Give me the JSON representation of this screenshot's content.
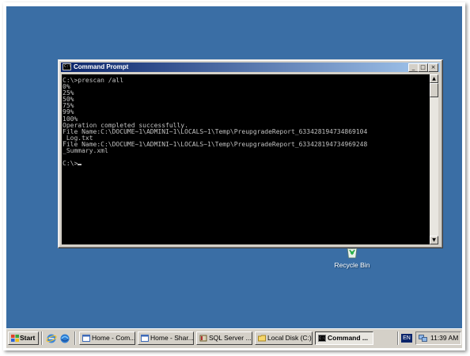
{
  "desktop": {
    "background_color": "#3a6ea5",
    "icons": [
      {
        "label": "Recycle Bin",
        "icon": "recycle-bin-icon"
      }
    ]
  },
  "window": {
    "title": "Command Prompt",
    "icon": "cmd-icon",
    "controls": {
      "minimize": "_",
      "maximize": "□",
      "close": "×"
    },
    "console": {
      "lines": [
        "C:\\>prescan /all",
        "0%",
        "25%",
        "50%",
        "75%",
        "99%",
        "100%",
        "Operation completed successfully.",
        "File Name:C:\\DOCUME~1\\ADMINI~1\\LOCALS~1\\Temp\\PreupgradeReport_633428194734869104",
        "_Log.txt",
        "File Name:C:\\DOCUME~1\\ADMINI~1\\LOCALS~1\\Temp\\PreupgradeReport_633428194734969248",
        "_Summary.xml",
        "",
        "C:\\>"
      ],
      "text_color": "#c0c0c0",
      "background": "#000000"
    }
  },
  "taskbar": {
    "start_label": "Start",
    "quick_launch": [
      "ie-icon",
      "explorer-icon"
    ],
    "tasks": [
      {
        "label": "Home - Com...",
        "icon": "ie-page-icon",
        "active": false
      },
      {
        "label": "Home - Shar...",
        "icon": "ie-page-icon",
        "active": false
      },
      {
        "label": "SQL Server ...",
        "icon": "sql-server-icon",
        "active": false
      },
      {
        "label": "Local Disk (C:)",
        "icon": "folder-icon",
        "active": false
      },
      {
        "label": "Command ...",
        "icon": "cmd-icon",
        "active": true
      }
    ],
    "language": "EN",
    "clock": "11:39 AM"
  }
}
